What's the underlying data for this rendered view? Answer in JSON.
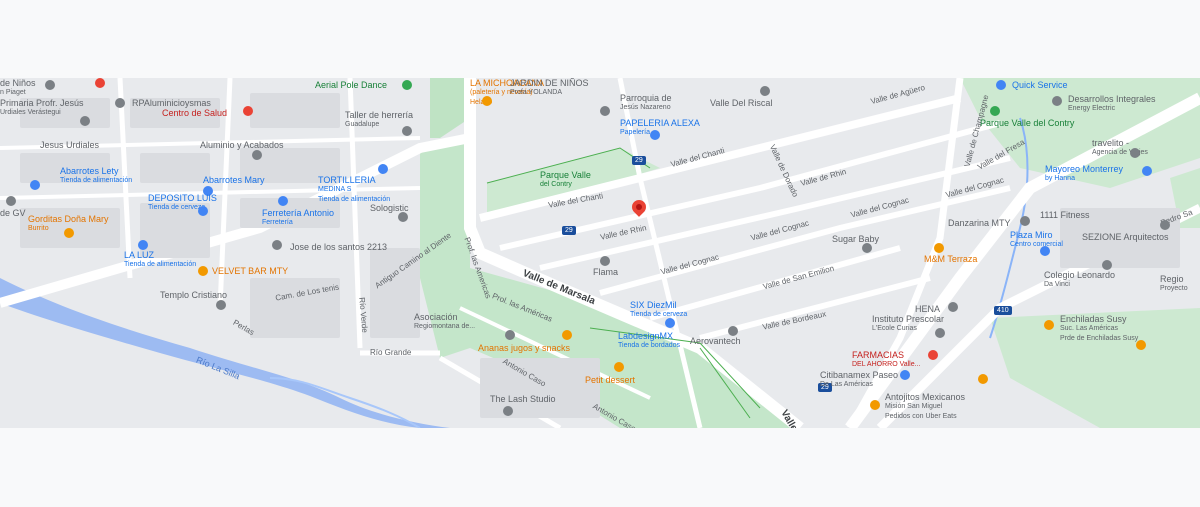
{
  "map": {
    "river": "Río La Silla",
    "streets": {
      "marsala": "Valle de Marsala",
      "chanti": "Valle del Chanti",
      "rhin": "Valle de Rhin",
      "cognac": "Valle del Cognac",
      "cognac2": "Valle del Cognac",
      "san_emilion": "Valle de San Emilion",
      "bordeaux": "Valle de Bordeaux",
      "aguero": "Valle de Agüero",
      "champagne": "Valle de Champagne",
      "fresa": "Valle del Fresa",
      "cognac3": "Valle del Cognac",
      "rhin2": "Valle de Rhin",
      "dorado": "Valle de Dorado",
      "prof_americas": "Prof. las Americas",
      "prol_americas": "Prol. las Américas",
      "antiguo": "Antiguo Camino al Diente",
      "cam_tenis": "Cam. de Los tenis",
      "rio_verde": "Río Verde",
      "rio_grande": "Río Grande",
      "perlas": "Perlas",
      "antonio_caso": "Antonio Caso",
      "valle_bottom": "Valle",
      "pedro_sa": "Pedro Sa"
    },
    "shields": {
      "a": "29",
      "b": "29",
      "c": "29",
      "d": "410"
    },
    "pois": [
      {
        "id": "jardin-ninos-top",
        "name": "de Niños",
        "sub": "n Piaget",
        "color": "gray"
      },
      {
        "id": "primaria",
        "name": "Primaria Profr. Jesús",
        "sub": "Urdiales Verástegui",
        "color": "gray"
      },
      {
        "id": "rpa",
        "name": "RPAluminicioysmas",
        "color": "gray"
      },
      {
        "id": "centro-salud",
        "name": "Centro de Salud",
        "color": "red"
      },
      {
        "id": "aerial",
        "name": "Aerial Pole Dance",
        "color": "green"
      },
      {
        "id": "michoacana",
        "name": "LA MICHOACANA",
        "sub": "(paletería y nevería)",
        "extra": "Helado",
        "color": "orange"
      },
      {
        "id": "jardin-yolanda",
        "name": "JARDIN DE NIÑOS",
        "sub": "Profa YOLANDA",
        "color": "gray"
      },
      {
        "id": "parroquia",
        "name": "Parroquia de",
        "sub": "Jesús Nazareno",
        "color": "gray"
      },
      {
        "id": "valle-riscal",
        "name": "Valle Del Riscal",
        "color": "gray"
      },
      {
        "id": "quick-service",
        "name": "Quick Service",
        "color": "blue"
      },
      {
        "id": "desarrollos",
        "name": "Desarrollos Integrales",
        "sub": "Energy Electric",
        "color": "gray"
      },
      {
        "id": "jesus-urdiales",
        "name": "Jesus Urdiales",
        "color": "gray"
      },
      {
        "id": "taller",
        "name": "Taller de herrería",
        "sub": "Guadalupe",
        "color": "gray"
      },
      {
        "id": "aluminio",
        "name": "Aluminio y Acabados",
        "color": "gray"
      },
      {
        "id": "papeleria",
        "name": "PAPELERIA ALEXA",
        "sub": "Papelería",
        "color": "blue"
      },
      {
        "id": "parque-contry",
        "name": "Parque Valle del Contry",
        "color": "green"
      },
      {
        "id": "travelito",
        "name": "travelito -",
        "sub": "Agencia de Viajes",
        "color": "gray"
      },
      {
        "id": "abarrotes-lety",
        "name": "Abarrotes Lety",
        "sub": "Tienda de alimentación",
        "color": "blue"
      },
      {
        "id": "abarrotes-mary",
        "name": "Abarrotes Mary",
        "color": "blue"
      },
      {
        "id": "tortilleria",
        "name": "TORTILLERIA",
        "sub": "MEDINA S",
        "extra": "Tienda de alimentación",
        "color": "blue"
      },
      {
        "id": "parque-valle",
        "name": "Parque Valle",
        "sub": "del Contry",
        "color": "green"
      },
      {
        "id": "mayoreo",
        "name": "Mayoreo Monterrey",
        "sub": "by Hanna",
        "color": "blue"
      },
      {
        "id": "gv",
        "name": "de GV",
        "color": "gray"
      },
      {
        "id": "deposito",
        "name": "DEPOSITO LUIS",
        "sub": "Tienda de cerveza",
        "color": "blue"
      },
      {
        "id": "ferreteria",
        "name": "Ferretería Antonio",
        "sub": "Ferretería",
        "color": "blue"
      },
      {
        "id": "sologistic",
        "name": "Sologistic",
        "color": "gray"
      },
      {
        "id": "gorditas",
        "name": "Gorditas Doña Mary",
        "sub": "Burrito",
        "color": "orange"
      },
      {
        "id": "fitness",
        "name": "1111 Fitness",
        "color": "gray"
      },
      {
        "id": "danzarina",
        "name": "Danzarina MTY",
        "color": "gray"
      },
      {
        "id": "sezione",
        "name": "SEZIONE Arquitectos",
        "color": "gray"
      },
      {
        "id": "jose",
        "name": "Jose de los santos 2213",
        "color": "gray"
      },
      {
        "id": "plaza-miro",
        "name": "Plaza Miro",
        "sub": "Centro comercial",
        "color": "blue"
      },
      {
        "id": "la-luz",
        "name": "LA LUZ",
        "sub": "Tienda de alimentación",
        "color": "blue"
      },
      {
        "id": "velvet",
        "name": "VELVET BAR MTY",
        "color": "orange"
      },
      {
        "id": "sugar",
        "name": "Sugar Baby",
        "color": "gray"
      },
      {
        "id": "mm-terraza",
        "name": "M&M Terraza",
        "color": "orange"
      },
      {
        "id": "colegio",
        "name": "Colegio Leonardo",
        "sub": "Da Vinci",
        "color": "gray"
      },
      {
        "id": "proyectos",
        "name": "Regio",
        "sub": "Proyecto",
        "color": "gray"
      },
      {
        "id": "templo",
        "name": "Templo Cristiano",
        "color": "gray"
      },
      {
        "id": "flama",
        "name": "Flama",
        "color": "gray"
      },
      {
        "id": "henna",
        "name": "HENA",
        "color": "gray"
      },
      {
        "id": "six",
        "name": "SIX DiezMil",
        "sub": "Tienda de cerveza",
        "color": "blue"
      },
      {
        "id": "asociacion",
        "name": "Asociación",
        "sub": "Regiomontana de...",
        "color": "gray"
      },
      {
        "id": "instituto",
        "name": "Instituto Prescolar",
        "sub": "L'Ecole Curias",
        "color": "gray"
      },
      {
        "id": "enchiladas",
        "name": "Enchiladas Susy",
        "sub": "Suc. Las Américas",
        "extra": "Prde de Enchiladas Susy",
        "color": "gray"
      },
      {
        "id": "labdesign",
        "name": "LabdesignMX",
        "sub": "Tienda de bordados",
        "color": "blue"
      },
      {
        "id": "aerovantech",
        "name": "Aerovantech",
        "color": "gray"
      },
      {
        "id": "ananas",
        "name": "Ananas jugos y snacks",
        "color": "orange"
      },
      {
        "id": "farmacias",
        "name": "FARMACIAS",
        "sub": "DEL AHORRO Valle...",
        "color": "red"
      },
      {
        "id": "citibanamex",
        "name": "Citibanamex Paseo",
        "sub": "De Las Américas",
        "color": "gray"
      },
      {
        "id": "petit",
        "name": "Petit dessert",
        "color": "orange"
      },
      {
        "id": "lash",
        "name": "The Lash Studio",
        "color": "gray"
      },
      {
        "id": "antojitos",
        "name": "Antojitos Mexicanos",
        "sub": "Misión San Miguel",
        "extra": "Pedidos con Uber Eats",
        "color": "gray"
      }
    ]
  }
}
